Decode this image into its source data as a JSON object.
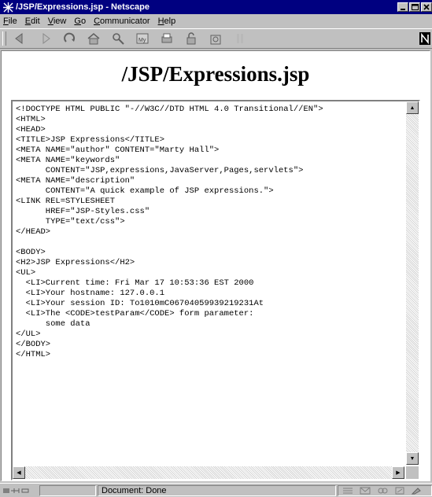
{
  "window": {
    "title": "/JSP/Expressions.jsp - Netscape"
  },
  "menu": [
    "File",
    "Edit",
    "View",
    "Go",
    "Communicator",
    "Help"
  ],
  "toolbar": {
    "icons": [
      "back-icon",
      "forward-icon",
      "reload-icon",
      "home-icon",
      "search-icon",
      "my-netscape-icon",
      "print-icon",
      "security-icon",
      "shop-icon",
      "stop-icon"
    ]
  },
  "page": {
    "heading": "/JSP/Expressions.jsp",
    "code_lines": [
      "<!DOCTYPE HTML PUBLIC \"-//W3C//DTD HTML 4.0 Transitional//EN\">",
      "<HTML>",
      "<HEAD>",
      "<TITLE>JSP Expressions</TITLE>",
      "<META NAME=\"author\" CONTENT=\"Marty Hall\">",
      "<META NAME=\"keywords\"",
      "      CONTENT=\"JSP,expressions,JavaServer,Pages,servlets\">",
      "<META NAME=\"description\"",
      "      CONTENT=\"A quick example of JSP expressions.\">",
      "<LINK REL=STYLESHEET",
      "      HREF=\"JSP-Styles.css\"",
      "      TYPE=\"text/css\">",
      "</HEAD>",
      "",
      "<BODY>",
      "<H2>JSP Expressions</H2>",
      "<UL>",
      "  <LI>Current time: Fri Mar 17 10:53:36 EST 2000",
      "  <LI>Your hostname: 127.0.0.1",
      "  <LI>Your session ID: To1010mC06704059939219231At",
      "  <LI>The <CODE>testParam</CODE> form parameter:",
      "      some data",
      "</UL>",
      "</BODY>",
      "</HTML>"
    ]
  },
  "status": {
    "text": "Document: Done"
  },
  "colors": {
    "titlebar": "#000080",
    "chrome": "#c0c0c0",
    "page": "#ffffff"
  }
}
